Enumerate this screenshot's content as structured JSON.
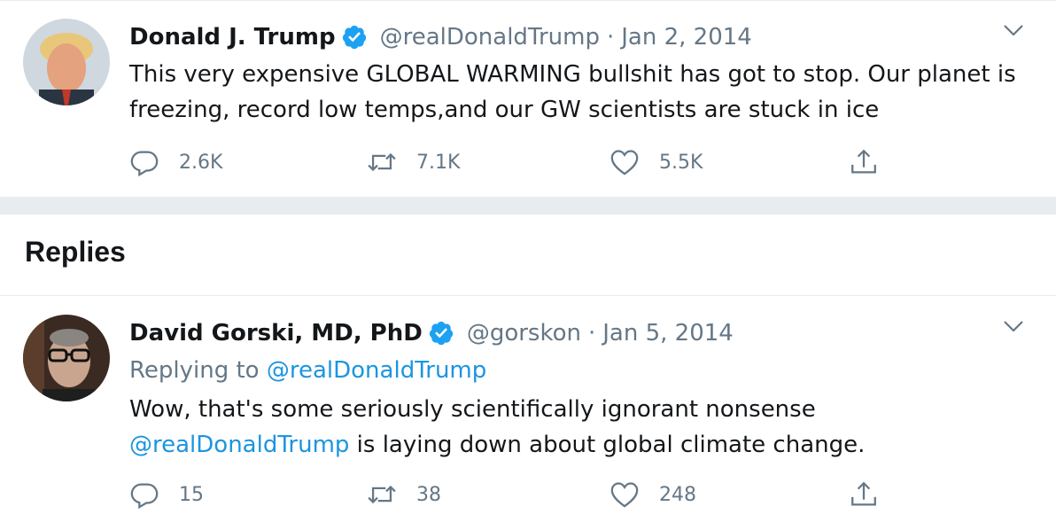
{
  "tweet": {
    "author": {
      "display_name": "Donald J. Trump",
      "handle": "@realDonaldTrump",
      "verified": true,
      "avatar_icon": "profile-photo"
    },
    "separator": "·",
    "date": "Jan 2, 2014",
    "text": "This very expensive GLOBAL WARMING bullshit has got to stop. Our planet is freezing, record low temps,and our GW scientists are stuck in ice",
    "stats": {
      "replies": "2.6K",
      "retweets": "7.1K",
      "likes": "5.5K"
    }
  },
  "replies_section": {
    "heading": "Replies"
  },
  "reply": {
    "author": {
      "display_name": "David Gorski, MD, PhD",
      "handle": "@gorskon",
      "verified": true,
      "avatar_icon": "profile-photo"
    },
    "separator": "·",
    "date": "Jan 5, 2014",
    "replying_prefix": "Replying to",
    "replying_to": "@realDonaldTrump",
    "text_before": "Wow, that's some seriously scientifically ignorant nonsense",
    "mention": "@realDonaldTrump",
    "text_after": "is laying down about global climate change.",
    "stats": {
      "replies": "15",
      "retweets": "38",
      "likes": "248"
    }
  },
  "colors": {
    "link": "#1b95e0",
    "muted": "#657786",
    "verified": "#1da1f2",
    "band": "#e6ecf0"
  }
}
